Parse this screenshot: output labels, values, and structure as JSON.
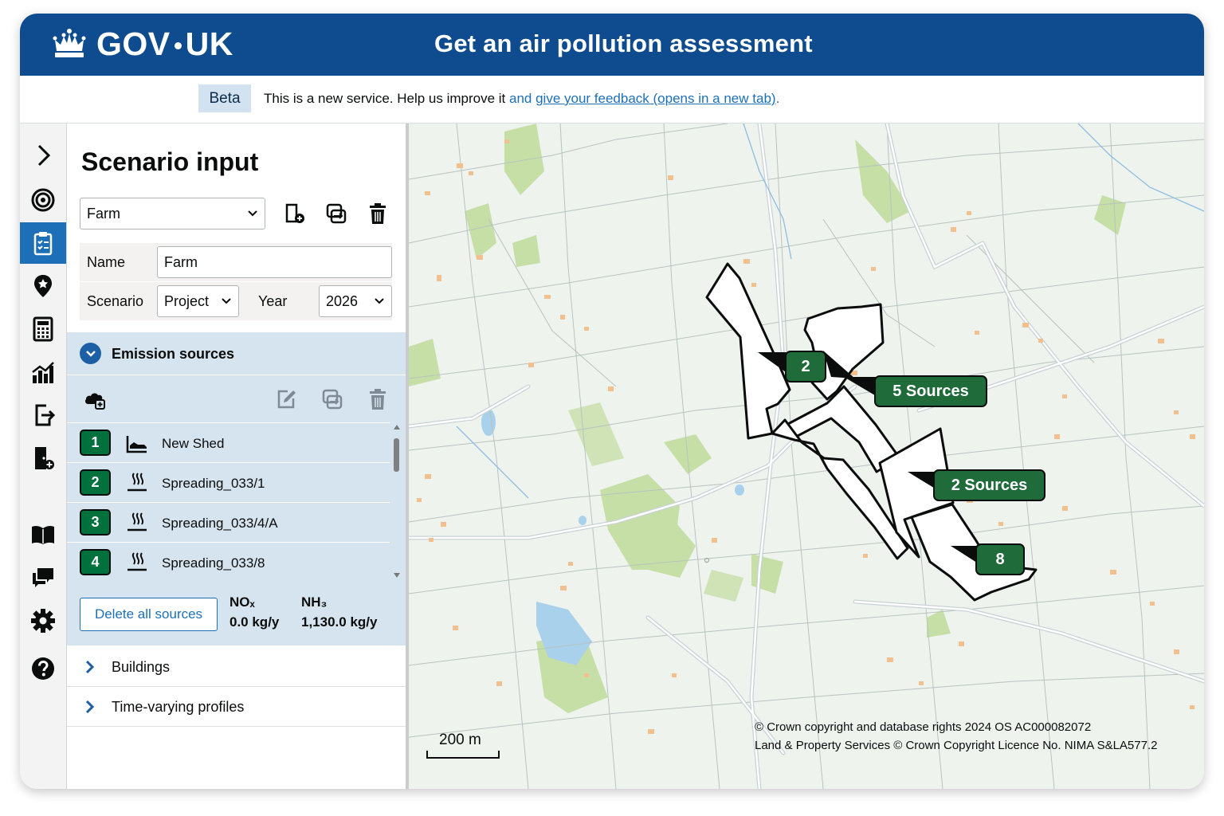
{
  "header": {
    "logo_text_left": "GOV",
    "logo_text_right": "UK",
    "service_title": "Get an air pollution assessment"
  },
  "phase_banner": {
    "tag": "Beta",
    "text_prefix": "This is a new service. Help us improve it ",
    "text_and": "and ",
    "link_text": "give your feedback (opens in a new tab)",
    "text_suffix": "."
  },
  "rail": {
    "items": [
      {
        "icon": "chevron-right-icon"
      },
      {
        "icon": "target-icon"
      },
      {
        "icon": "clipboard-icon",
        "active": true
      },
      {
        "icon": "location-pin-icon"
      },
      {
        "icon": "calculator-icon"
      },
      {
        "icon": "chart-icon"
      },
      {
        "icon": "export-icon"
      },
      {
        "icon": "door-add-icon"
      },
      {
        "icon": "book-icon"
      },
      {
        "icon": "chat-icon"
      },
      {
        "icon": "gear-icon"
      },
      {
        "icon": "help-icon"
      }
    ]
  },
  "panel": {
    "title": "Scenario input",
    "situation_select": "Farm",
    "name_label": "Name",
    "name_value": "Farm",
    "scenario_label": "Scenario",
    "scenario_value": "Project",
    "year_label": "Year",
    "year_value": "2026"
  },
  "emission_sources": {
    "title": "Emission sources",
    "sources": [
      {
        "number": "1",
        "label": "New Shed",
        "icon": "animal-housing-icon"
      },
      {
        "number": "2",
        "label": "Spreading_033/1",
        "icon": "manure-spreading-icon"
      },
      {
        "number": "3",
        "label": "Spreading_033/4/A",
        "icon": "manure-spreading-icon"
      },
      {
        "number": "4",
        "label": "Spreading_033/8",
        "icon": "manure-spreading-icon"
      }
    ],
    "delete_all_label": "Delete all sources",
    "nox_label": "NOₓ",
    "nox_value": "0.0 kg/y",
    "nh3_label": "NH₃",
    "nh3_value": "1,130.0 kg/y"
  },
  "collapsed_sections": [
    {
      "label": "Buildings"
    },
    {
      "label": "Time-varying profiles"
    }
  ],
  "map": {
    "labels": [
      {
        "text": "2"
      },
      {
        "text": "5 Sources"
      },
      {
        "text": "2 Sources"
      },
      {
        "text": "8"
      }
    ],
    "scale_text": "200 m",
    "copyright_line1": "© Crown copyright and database rights 2024 OS AC000082072",
    "copyright_line2": "Land & Property Services © Crown Copyright Licence No. NIMA S&LA577.2"
  },
  "colors": {
    "header_blue": "#0f4c8f",
    "active_blue": "#1d70b8",
    "source_green": "#00703c",
    "sources_bg": "#d5e4ef"
  }
}
